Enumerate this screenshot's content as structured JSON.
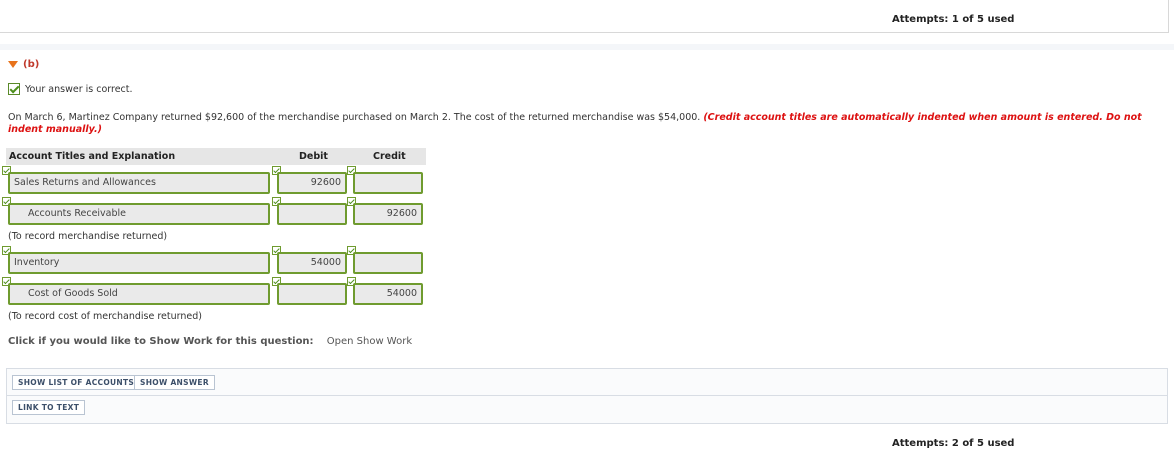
{
  "attempts_top": "Attempts: 1 of 5 used",
  "part": {
    "label": "(b)"
  },
  "feedback": "Your answer is correct.",
  "question": {
    "text": "On March 6, Martinez Company returned $92,600 of the merchandise purchased on March 2. The cost of the returned merchandise was $54,000.",
    "hint": "(Credit account titles are automatically indented when amount is entered. Do not indent manually.)"
  },
  "table": {
    "headers": {
      "account": "Account Titles and Explanation",
      "debit": "Debit",
      "credit": "Credit"
    },
    "rows": [
      {
        "account": "Sales Returns and Allowances",
        "debit": "92600",
        "credit": ""
      },
      {
        "account": "Accounts Receivable",
        "debit": "",
        "credit": "92600"
      },
      {
        "account": "Inventory",
        "debit": "54000",
        "credit": ""
      },
      {
        "account": "Cost of Goods Sold",
        "debit": "",
        "credit": "54000"
      }
    ],
    "notes": [
      "(To record merchandise returned)",
      "(To record cost of merchandise returned)"
    ]
  },
  "show_work": {
    "label": "Click if you would like to Show Work for this question:",
    "link": "Open Show Work"
  },
  "buttons": {
    "show_list": "SHOW LIST OF ACCOUNTS",
    "show_answer": "SHOW ANSWER",
    "link_to_text": "LINK TO TEXT"
  },
  "attempts_bottom": "Attempts: 2 of 5 used",
  "colors": {
    "accent": "#e8731c",
    "correct_border": "#6f9b2f",
    "hint": "#dd1111"
  }
}
